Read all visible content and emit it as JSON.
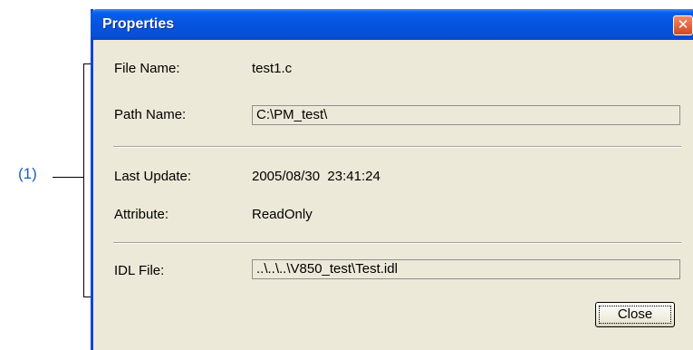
{
  "annotation": {
    "label": "(1)"
  },
  "dialog": {
    "title": "Properties",
    "close_icon": "close-icon",
    "file_name_label": "File Name:",
    "file_name_value": "test1.c",
    "path_name_label": "Path Name:",
    "path_name_value": "C:\\PM_test\\",
    "last_update_label": "Last Update:",
    "last_update_value": "2005/08/30  23:41:24",
    "attribute_label": "Attribute:",
    "attribute_value": "ReadOnly",
    "idl_file_label": "IDL File:",
    "idl_file_value": "..\\..\\..\\V850_test\\Test.idl",
    "close_button_label": "Close"
  },
  "colors": {
    "titlebar": "#0553e0",
    "window_bg": "#ece9d8",
    "callout": "#1f5fbf"
  }
}
